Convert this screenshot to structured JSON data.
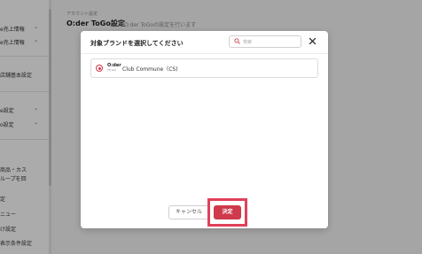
{
  "sidebar": {
    "items": [
      {
        "label": "e売上情報",
        "chevron": "⌄"
      },
      {
        "label": "e売上情報",
        "chevron": "⌄"
      },
      {
        "label": "店舗基本設定"
      },
      {
        "label": "e設定",
        "chevron": "⌄"
      },
      {
        "label": "o設定",
        "chevron": "⌄"
      },
      {
        "label": "商品・カス"
      },
      {
        "label": "ループを回"
      },
      {
        "label": "定"
      },
      {
        "label": "ニュー"
      },
      {
        "label": "け設定"
      },
      {
        "label": "表示条件設定"
      }
    ]
  },
  "page": {
    "breadcrumb": "アカウント設定",
    "title": "O:der ToGo設定",
    "description": "O:der ToGoの設定を行います"
  },
  "modal": {
    "title": "対象ブランドを選択してください",
    "search_placeholder": "検索",
    "close_icon": "close-icon",
    "options": [
      {
        "logo_text": "O:der",
        "logo_subtext": "TO GO",
        "label": "Club Commune（CS)",
        "selected": true
      }
    ],
    "cancel_label": "キャンセル",
    "confirm_label": "決定"
  },
  "colors": {
    "accent": "#cf3a4c",
    "highlight": "#e0405a",
    "overlay": "rgba(0,0,0,0.33)"
  }
}
